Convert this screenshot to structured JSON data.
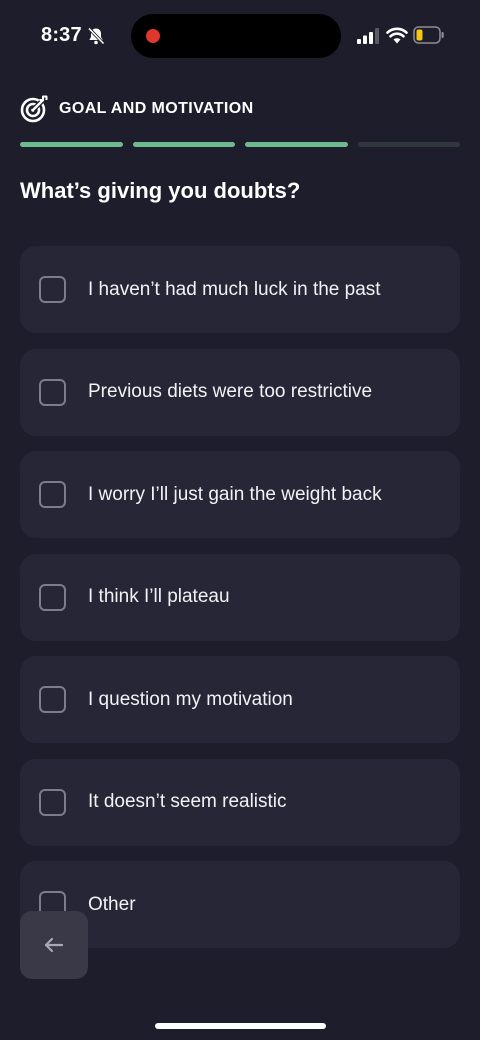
{
  "status_bar": {
    "time": "8:37",
    "icons": [
      "bell-slash-icon",
      "signal-icon",
      "wifi-icon",
      "battery-icon"
    ]
  },
  "header": {
    "icon": "target-icon",
    "title": "GOAL AND MOTIVATION"
  },
  "progress": {
    "total_steps": 4,
    "completed_steps": 3,
    "colors": {
      "done": "#6dbb8c",
      "pending": "#30383e"
    }
  },
  "question": {
    "title": "What’s giving you doubts?"
  },
  "options": [
    {
      "label": "I haven’t had much luck in the past",
      "checked": false
    },
    {
      "label": "Previous diets were too restrictive",
      "checked": false
    },
    {
      "label": "I worry I’ll just gain the weight back",
      "checked": false
    },
    {
      "label": "I think I’ll plateau",
      "checked": false
    },
    {
      "label": "I question my motivation",
      "checked": false
    },
    {
      "label": "It doesn’t seem realistic",
      "checked": false
    },
    {
      "label": "Other",
      "checked": false
    }
  ],
  "back_button": {
    "icon": "arrow-left-icon"
  },
  "colors": {
    "background": "#1e1d2b",
    "card": "#272636",
    "accent": "#6dbb8c",
    "record_dot": "#e0362c"
  }
}
